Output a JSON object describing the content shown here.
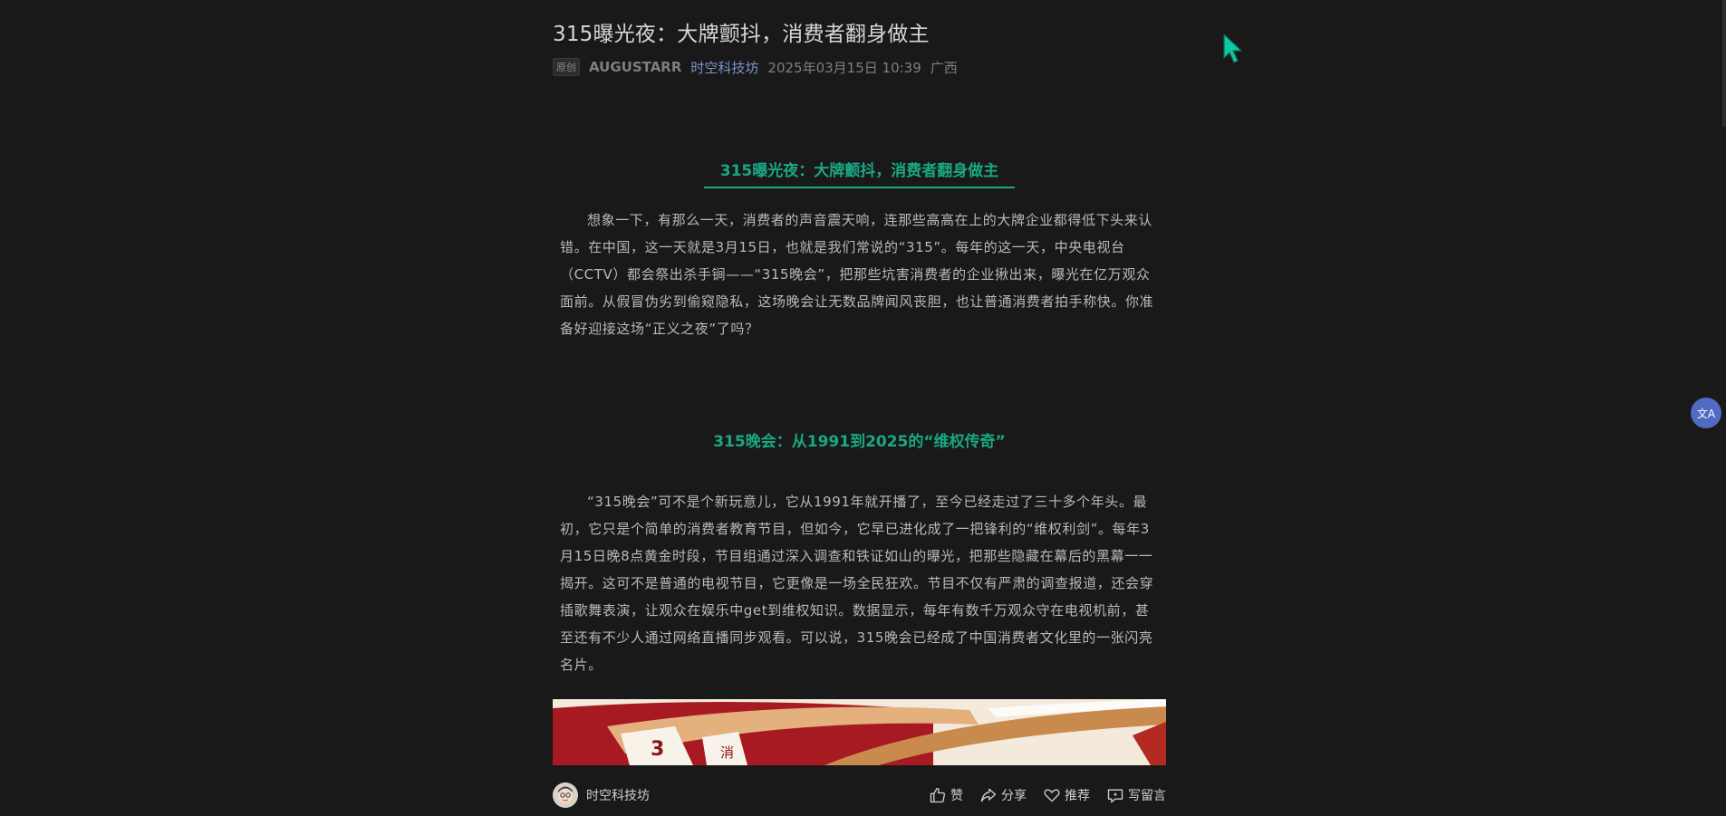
{
  "article": {
    "title": "315曝光夜：大牌颤抖，消费者翻身做主",
    "meta": {
      "tag": "原创",
      "author": "AUGUSTARR",
      "account": "时空科技坊",
      "date": "2025年03月15日 10:39",
      "location": "广西"
    },
    "section1_title": "315曝光夜：大牌颤抖，消费者翻身做主",
    "paragraph1": "想象一下，有那么一天，消费者的声音震天响，连那些高高在上的大牌企业都得低下头来认错。在中国，这一天就是3月15日，也就是我们常说的“315”。每年的这一天，中央电视台（CCTV）都会祭出杀手锏——“315晚会”，把那些坑害消费者的企业揪出来，曝光在亿万观众面前。从假冒伪劣到偷窥隐私，这场晚会让无数品牌闻风丧胆，也让普通消费者拍手称快。你准备好迎接这场“正义之夜”了吗？",
    "section2_title": "315晚会：从1991到2025的“维权传奇”",
    "paragraph2": "“315晚会”可不是个新玩意儿，它从1991年就开播了，至今已经走过了三十多个年头。最初，它只是个简单的消费者教育节目，但如今，它早已进化成了一把锋利的“维权利剑”。每年3月15日晚8点黄金时段，节目组通过深入调查和铁证如山的曝光，把那些隐藏在幕后的黑幕一一揭开。这可不是普通的电视节目，它更像是一场全民狂欢。节目不仅有严肃的调查报道，还会穿插歌舞表演，让观众在娱乐中get到维权知识。数据显示，每年有数千万观众守在电视机前，甚至还有不少人通过网络直播同步观看。可以说，315晚会已经成了中国消费者文化里的一张闪亮名片。",
    "banner_text": [
      "3",
      "消"
    ]
  },
  "bottom_bar": {
    "account_name": "时空科技坊",
    "like_label": "赞",
    "share_label": "分享",
    "recommend_label": "推荐",
    "comment_label": "写留言"
  },
  "translate_button": {
    "label": "文A"
  },
  "colors": {
    "background": "#191919",
    "accent": "#19a884",
    "link": "#7a93c7",
    "translate_button": "#4f6bc2",
    "cursor": "#11c6a3"
  },
  "icons": [
    "thumbs-up-icon",
    "share-icon",
    "heart-icon",
    "comment-icon",
    "translate-icon",
    "avatar",
    "mouse-cursor-icon"
  ]
}
